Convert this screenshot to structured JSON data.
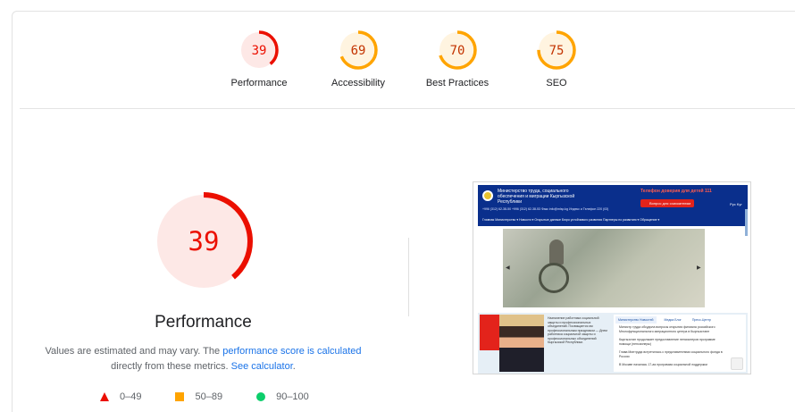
{
  "colors": {
    "fail": "#eb0f00",
    "fail_bg": "#fde8e6",
    "average": "#ffa400",
    "average_bg": "#fff4e0",
    "pass": "#0cce6b",
    "link": "#1a73e8"
  },
  "summary": [
    {
      "label": "Performance",
      "score": 39,
      "rating": "fail"
    },
    {
      "label": "Accessibility",
      "score": 69,
      "rating": "average"
    },
    {
      "label": "Best Practices",
      "score": 70,
      "rating": "average"
    },
    {
      "label": "SEO",
      "score": 75,
      "rating": "average"
    }
  ],
  "detail": {
    "score": 39,
    "title": "Performance",
    "note_prefix": "Values are estimated and may vary. The ",
    "note_link1": "performance score is calculated",
    "note_middle": " directly from these metrics. ",
    "note_link2": "See calculator",
    "note_suffix": "."
  },
  "legend": [
    {
      "range": "0–49",
      "icon": "triangle-icon"
    },
    {
      "range": "50–89",
      "icon": "square-icon"
    },
    {
      "range": "90–100",
      "icon": "circle-icon"
    }
  ],
  "thumbnail": {
    "site_title": "Министерство труда, социального обеспечения и миграции Кыргызской Республики",
    "hotline": "Телефон доверия для детей 111",
    "button": "Вопрос для соискателям",
    "contacts": "+996 (312) 62-38-50    +996 (312) 62-38-53    Факс    info@mlsp.kg    Индекс и Телефон 220 (03)",
    "nav": "Главная   Министерство ▾   Новости ▾   Открытые данные   Бюро устойчивого развития   Партнеры по развитию ▾   Обращение ▾",
    "lang": "Рус  Kyr",
    "article": "Назначение работника социальной защиты и профессиональных объединений. Посвящается им профессиональным праздником — Днем работника социальной защиты и профессиональных объединений Кыргызской Республики.",
    "tabs": [
      "Министерство Новостей",
      "Медиа Блог",
      "Пресс-Центр"
    ],
    "news": [
      "Министр труда обсудила вопросы открытия филиала российского Многофункционального миграционного центра в Кыргызстане",
      "Кыргызстан продолжает предоставление пенсионеров программе помощи (пенсионеры)",
      "Глава Минтруда встретилась с представителями социального фонда в России",
      "В Москве началась 17-ая программа социальной поддержки"
    ]
  }
}
